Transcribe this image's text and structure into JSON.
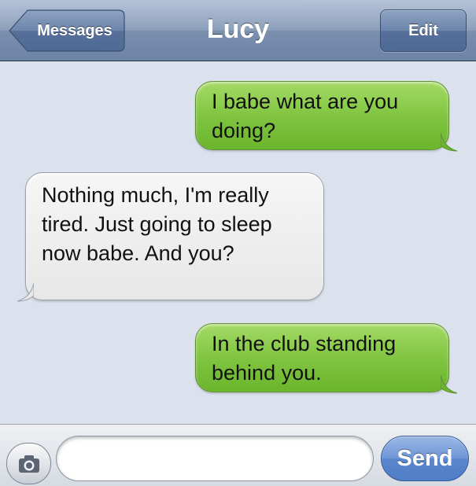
{
  "navbar": {
    "title": "Lucy",
    "back_label": "Messages",
    "edit_label": "Edit"
  },
  "messages": [
    {
      "direction": "outgoing",
      "text": "I babe what are you doing?"
    },
    {
      "direction": "incoming",
      "text": "Nothing much, I'm really tired. Just going to sleep now babe. And you?"
    },
    {
      "direction": "outgoing",
      "text": "In the club standing behind you."
    }
  ],
  "compose": {
    "placeholder": "",
    "value": "",
    "send_label": "Send",
    "camera_icon": "camera-icon"
  },
  "colors": {
    "outgoing_bubble": "#7ec33e",
    "incoming_bubble": "#eeeeee",
    "background": "#dbe2ed",
    "send_button": "#5a86cc"
  }
}
